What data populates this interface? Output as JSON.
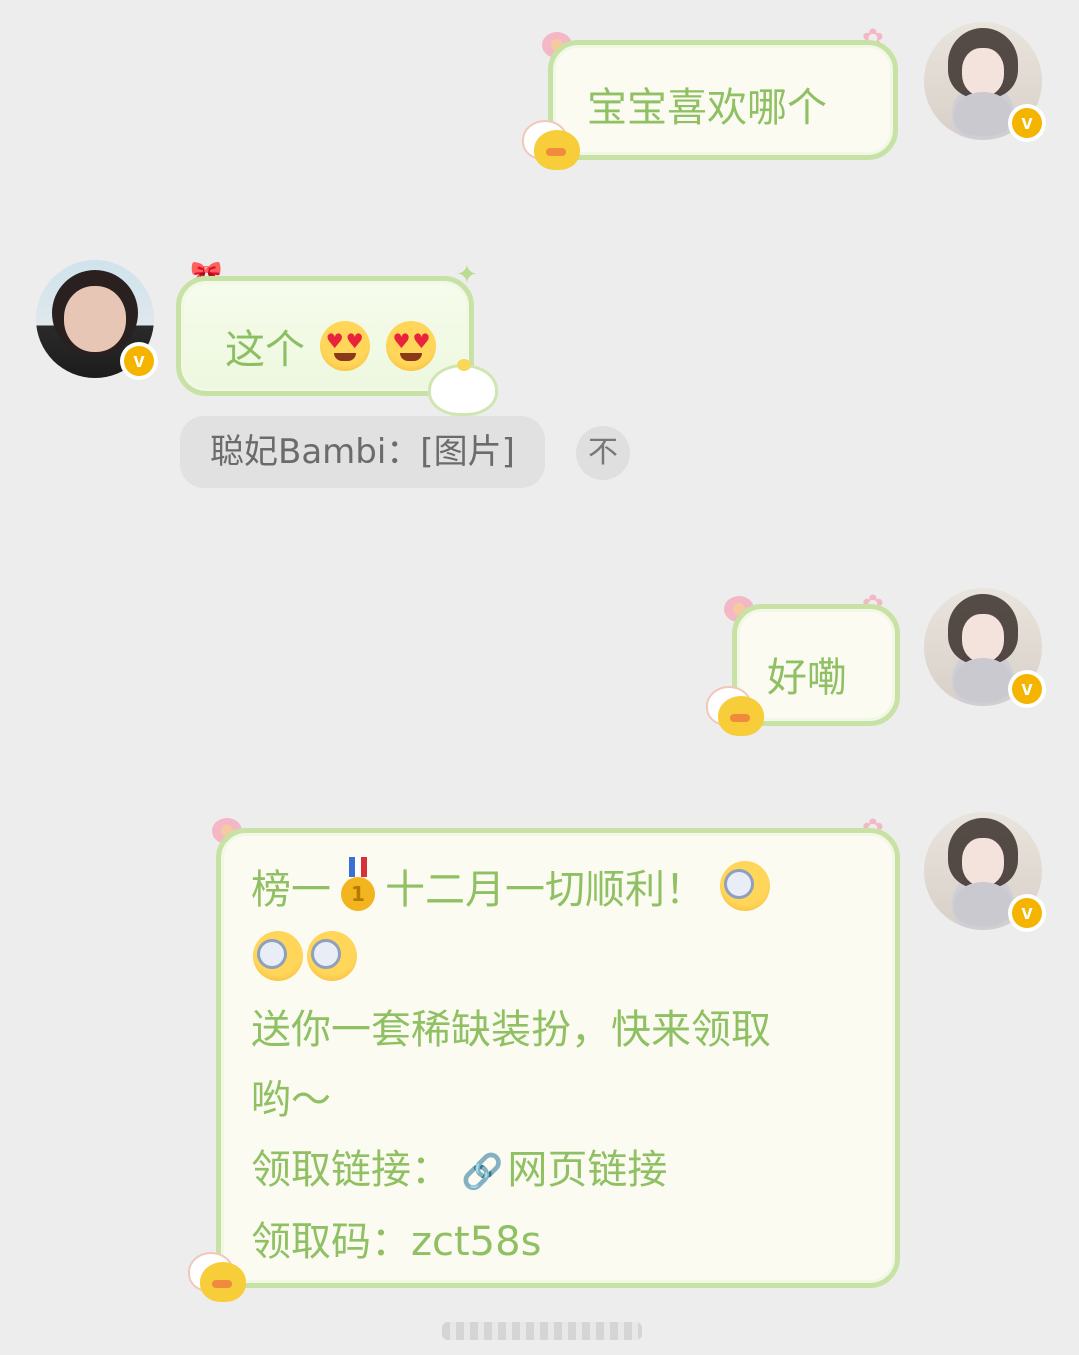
{
  "messages": [
    {
      "sender": "me",
      "text": "宝宝喜欢哪个"
    },
    {
      "sender": "other",
      "text": "这个",
      "emojis": [
        "heart-eyes-emoji",
        "heart-eyes-emoji"
      ],
      "quote": {
        "text": "聪妃Bambi：[图片]",
        "action_icon": "不"
      }
    },
    {
      "sender": "me",
      "text": "好嘞"
    },
    {
      "sender": "me",
      "lines": {
        "line1_prefix": "榜一",
        "medal_number": "1",
        "line1_suffix": "十二月一切顺利！",
        "line3": "送你一套稀缺装扮，快来领取",
        "line4": "哟～",
        "link_label": "领取链接：",
        "link_text": "网页链接",
        "code_label": "领取码：",
        "code_value": "zct58s"
      }
    }
  ],
  "verified_badge": "v",
  "colors": {
    "bubble_text": "#8fc063",
    "bubble_border": "#c7e2a4",
    "badge": "#f4b400",
    "link_icon": "#5b8fd8"
  }
}
